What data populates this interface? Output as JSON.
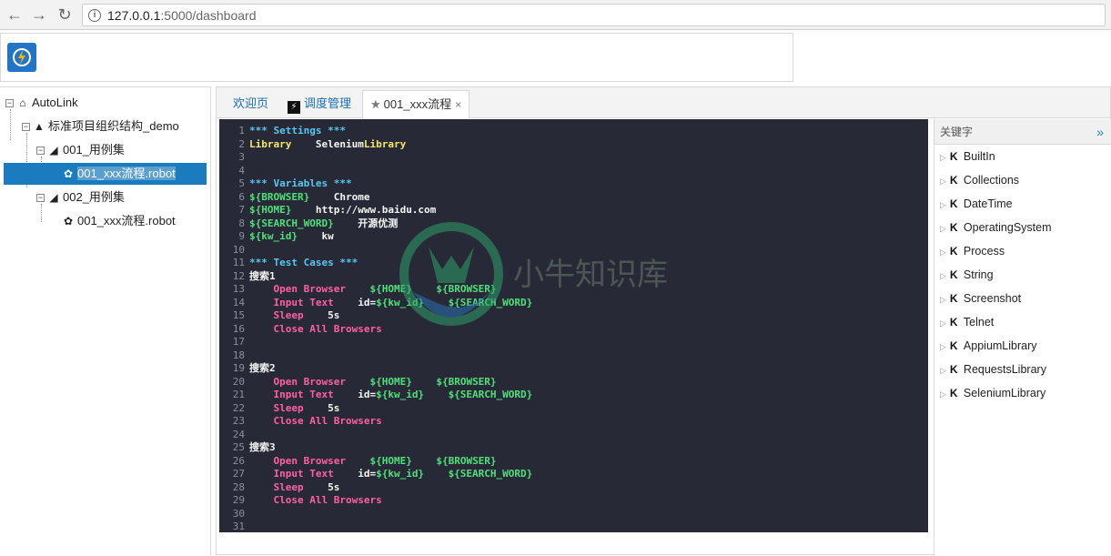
{
  "browser": {
    "back_icon": "arrow-left-icon",
    "forward_icon": "arrow-right-icon",
    "reload_icon": "reload-icon",
    "url_host": "127.0.0.1",
    "url_port_path": ":5000/dashboard"
  },
  "tree": {
    "root": "AutoLink",
    "project": "标准项目组织结构_demo",
    "suite1": "001_用例集",
    "suite1_file": "001_xxx流程.robot",
    "suite2": "002_用例集",
    "suite2_file": "001_xxx流程.robot"
  },
  "tabs": [
    {
      "label": "欢迎页"
    },
    {
      "label": "调度管理"
    },
    {
      "label": "001_xxx流程",
      "close": "×"
    }
  ],
  "editor": {
    "lines": [
      [
        [
          "c-sec",
          "*** Settings ***"
        ]
      ],
      [
        [
          "c-lib",
          "Library"
        ],
        [
          "c-txt",
          "    Selenium"
        ],
        [
          "c-lib",
          "Library"
        ]
      ],
      [],
      [],
      [
        [
          "c-sec",
          "*** Variables ***"
        ]
      ],
      [
        [
          "c-var",
          "${BROWSER}"
        ],
        [
          "c-txt",
          "    Chrome"
        ]
      ],
      [
        [
          "c-var",
          "${HOME}"
        ],
        [
          "c-txt",
          "    http://www.baidu.com"
        ]
      ],
      [
        [
          "c-var",
          "${SEARCH_WORD}"
        ],
        [
          "c-txt",
          "    开源优测"
        ]
      ],
      [
        [
          "c-var",
          "${kw_id}"
        ],
        [
          "c-txt",
          "    kw"
        ]
      ],
      [],
      [
        [
          "c-sec",
          "*** Test Cases ***"
        ]
      ],
      [
        [
          "c-txt",
          "搜索1"
        ]
      ],
      [
        [
          "c-kw",
          "    Open Browser"
        ],
        [
          "c-txt",
          "    "
        ],
        [
          "c-var",
          "${HOME}"
        ],
        [
          "c-txt",
          "    "
        ],
        [
          "c-var",
          "${BROWSER}"
        ]
      ],
      [
        [
          "c-kw",
          "    Input Text"
        ],
        [
          "c-txt",
          "    id="
        ],
        [
          "c-var",
          "${kw_id}"
        ],
        [
          "c-txt",
          "    "
        ],
        [
          "c-var",
          "${SEARCH_WORD}"
        ]
      ],
      [
        [
          "c-kw",
          "    Sleep"
        ],
        [
          "c-txt",
          "    5s"
        ]
      ],
      [
        [
          "c-kw",
          "    Close All Browsers"
        ]
      ],
      [],
      [],
      [
        [
          "c-txt",
          "搜索2"
        ]
      ],
      [
        [
          "c-kw",
          "    Open Browser"
        ],
        [
          "c-txt",
          "    "
        ],
        [
          "c-var",
          "${HOME}"
        ],
        [
          "c-txt",
          "    "
        ],
        [
          "c-var",
          "${BROWSER}"
        ]
      ],
      [
        [
          "c-kw",
          "    Input Text"
        ],
        [
          "c-txt",
          "    id="
        ],
        [
          "c-var",
          "${kw_id}"
        ],
        [
          "c-txt",
          "    "
        ],
        [
          "c-var",
          "${SEARCH_WORD}"
        ]
      ],
      [
        [
          "c-kw",
          "    Sleep"
        ],
        [
          "c-txt",
          "    5s"
        ]
      ],
      [
        [
          "c-kw",
          "    Close All Browsers"
        ]
      ],
      [],
      [
        [
          "c-txt",
          "搜索3"
        ]
      ],
      [
        [
          "c-kw",
          "    Open Browser"
        ],
        [
          "c-txt",
          "    "
        ],
        [
          "c-var",
          "${HOME}"
        ],
        [
          "c-txt",
          "    "
        ],
        [
          "c-var",
          "${BROWSER}"
        ]
      ],
      [
        [
          "c-kw",
          "    Input Text"
        ],
        [
          "c-txt",
          "    id="
        ],
        [
          "c-var",
          "${kw_id}"
        ],
        [
          "c-txt",
          "    "
        ],
        [
          "c-var",
          "${SEARCH_WORD}"
        ]
      ],
      [
        [
          "c-kw",
          "    Sleep"
        ],
        [
          "c-txt",
          "    5s"
        ]
      ],
      [
        [
          "c-kw",
          "    Close All Browsers"
        ]
      ],
      [],
      []
    ],
    "watermark_text": "小牛知识库"
  },
  "keywords": {
    "title": "关键字",
    "expand_icon": "double-chevron-right-icon",
    "items": [
      "BuiltIn",
      "Collections",
      "DateTime",
      "OperatingSystem",
      "Process",
      "String",
      "Screenshot",
      "Telnet",
      "AppiumLibrary",
      "RequestsLibrary",
      "SeleniumLibrary"
    ]
  }
}
